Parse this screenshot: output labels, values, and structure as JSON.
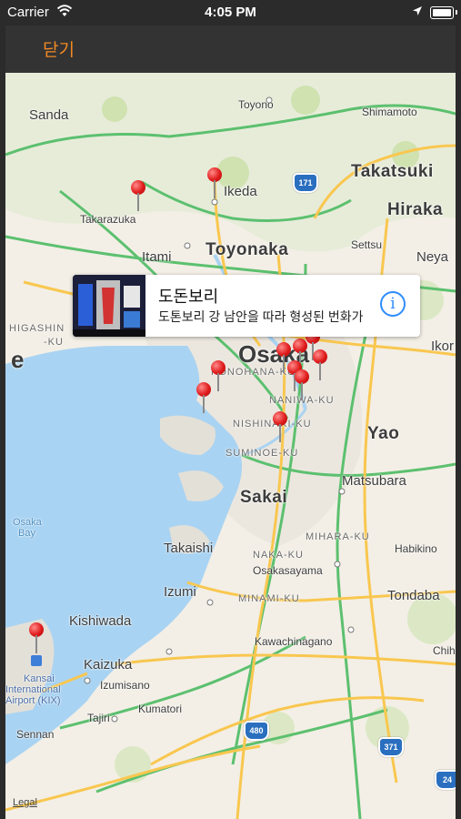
{
  "status_bar": {
    "carrier": "Carrier",
    "time": "4:05 PM"
  },
  "nav": {
    "close_label": "닫기"
  },
  "map": {
    "places": {
      "sanda": "Sanda",
      "toyono": "Toyono",
      "shimamoto": "Shimamoto",
      "takatsuki": "Takatsuki",
      "hirakata": "Hiraka",
      "ikeda": "Ikeda",
      "takarazuka": "Takarazuka",
      "itami": "Itami",
      "toyonaka": "Toyonaka",
      "settsu": "Settsu",
      "neyagawa": "Neya",
      "higashinada": "HIGASHIN",
      "higashinada2": "-KU",
      "osaka": "Osaka",
      "konohana": "KONOHANA-KU",
      "naniwa": "NANIWA-KU",
      "nishinari": "NISHINARI-KU",
      "suminoe": "SUMINOE-KU",
      "ikoma": "Ikor",
      "yao": "Yao",
      "sakai": "Sakai",
      "matsubara": "Matsubara",
      "habikino": "Habikino",
      "osaka_bay_1": "Osaka",
      "osaka_bay_2": "Bay",
      "takaishi": "Takaishi",
      "mihara": "MIHARA-KU",
      "naka": "NAKA-KU",
      "osakasayama": "Osakasayama",
      "izumi": "Izumi",
      "minami": "MINAMI-KU",
      "tondabayashi": "Tondaba",
      "kishiwada": "Kishiwada",
      "kawachinagano": "Kawachinagano",
      "kaizuka": "Kaizuka",
      "kumatori": "Kumatori",
      "izumisano": "Izumisano",
      "chihaya": "Chih",
      "kansai_1": "Kansai",
      "kansai_2": "International",
      "kansai_3": "Airport (KIX)",
      "tajiri": "Tajiri",
      "sennan": "Sennan",
      "e_left": "e"
    },
    "route_shields": {
      "r171": "171",
      "r480": "480",
      "r371": "371",
      "r24": "24"
    },
    "legal_label": "Legal"
  },
  "callout": {
    "title": "도돈보리",
    "subtitle": "도톤보리 강 남안을 따라 형성된 번화가"
  },
  "colors": {
    "accent": "#f08a24",
    "pin": "#e01b1b",
    "water": "#a9d3f2",
    "highway": "#f9c74f",
    "info": "#2f8cff"
  }
}
